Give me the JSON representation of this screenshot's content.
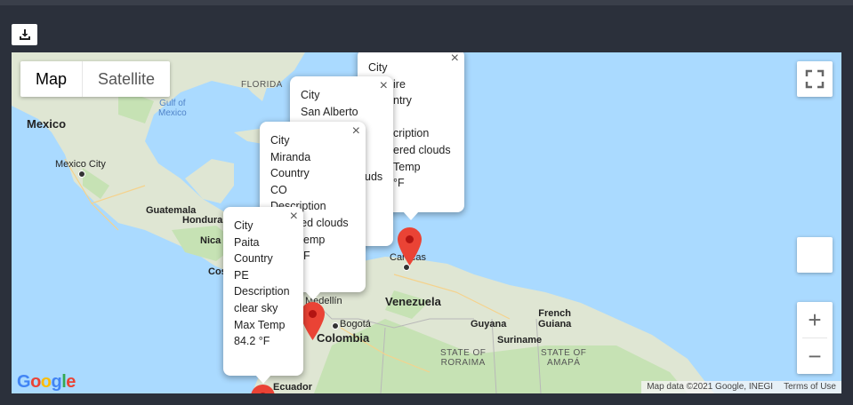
{
  "toolbar": {
    "download_icon": "download-icon"
  },
  "map_type": {
    "map_label": "Map",
    "satellite_label": "Satellite"
  },
  "labels": {
    "florida": "FLORIDA",
    "gulf": "Gulf of\nMexico",
    "mexico": "Mexico",
    "mexico_city": "Mexico City",
    "guatemala": "Guatemala",
    "honduras": "Honduras",
    "nica": "Nica",
    "cos": "Cos",
    "caracas": "Caracas",
    "venezuela": "Venezuela",
    "medellin": "Medellín",
    "bogota": "Bogotá",
    "colombia": "Colombia",
    "guyana": "Guyana",
    "suriname": "Suriname",
    "french_guiana": "French\nGuiana",
    "roraima": "STATE OF\nRORAIMA",
    "amapa": "STATE OF\nAMAPÁ",
    "ecuador": "Ecuador"
  },
  "info_windows": [
    {
      "lines": [
        "City",
        "Paita",
        "Country",
        "PE",
        "Description",
        "clear sky",
        "Max Temp",
        "84.2 °F"
      ]
    },
    {
      "lines": [
        "City",
        "Miranda",
        "Country",
        "CO",
        "Description",
        "red clouds",
        "emp",
        "F"
      ]
    },
    {
      "lines": [
        "City",
        "San Alberto",
        "",
        "",
        "",
        "uds",
        "",
        ""
      ]
    },
    {
      "lines": [
        "City",
        "ire",
        "ntry",
        "",
        "cription",
        "ered clouds",
        "Temp",
        "°F"
      ]
    }
  ],
  "controls": {
    "zoom_in": "+",
    "zoom_out": "−"
  },
  "footer": {
    "logo": "Google",
    "map_data": "Map data ©2021 Google, INEGI",
    "terms": "Terms of Use"
  },
  "colors": {
    "land": "#dfe6d3",
    "water": "#aadaff",
    "forest": "#c6e2b4",
    "pin": "#ea4335"
  }
}
